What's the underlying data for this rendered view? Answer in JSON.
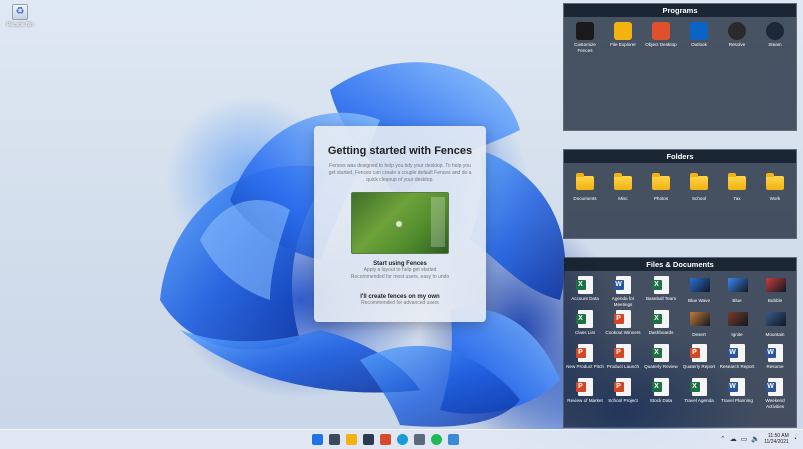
{
  "desktop": {
    "recycle_bin_label": "Recycle Bin"
  },
  "fences": {
    "programs": {
      "title": "Programs",
      "items": [
        {
          "label": "Customize Fences",
          "icon": "fences-icon",
          "color": "#1a1a1a"
        },
        {
          "label": "File Explorer",
          "icon": "folder-icon",
          "color": "#f2b20f"
        },
        {
          "label": "Object Desktop",
          "icon": "object-desktop-icon",
          "color": "#e0502a"
        },
        {
          "label": "Outlook",
          "icon": "outlook-icon",
          "color": "#0a64c8"
        },
        {
          "label": "Resolve",
          "icon": "resolve-icon",
          "color": "#2a2a2a"
        },
        {
          "label": "Steam",
          "icon": "steam-icon",
          "color": "#1b2838"
        }
      ]
    },
    "folders": {
      "title": "Folders",
      "items": [
        "Documents",
        "Misc",
        "Photos",
        "School",
        "Tax",
        "Work"
      ]
    },
    "files": {
      "title": "Files & Documents",
      "items": [
        {
          "label": "Account Data",
          "type": "excel"
        },
        {
          "label": "Agenda for Meetings",
          "type": "word"
        },
        {
          "label": "Baseball Team",
          "type": "excel"
        },
        {
          "label": "Blue Wave",
          "type": "image",
          "color": "#2a6fd6"
        },
        {
          "label": "Blue",
          "type": "image",
          "color": "#3b86ee"
        },
        {
          "label": "Bubble",
          "type": "image",
          "color": "#c43d3d"
        },
        {
          "label": "Class List",
          "type": "excel"
        },
        {
          "label": "Cookout Winners",
          "type": "powerpoint"
        },
        {
          "label": "Dashboards",
          "type": "excel"
        },
        {
          "label": "Desert",
          "type": "image",
          "color": "#c47a3a"
        },
        {
          "label": "Ignite",
          "type": "image",
          "color": "#7a3a2a"
        },
        {
          "label": "Mountain",
          "type": "image",
          "color": "#3a5a8a"
        },
        {
          "label": "New Product Pitch",
          "type": "powerpoint"
        },
        {
          "label": "Product Launch",
          "type": "powerpoint"
        },
        {
          "label": "Quaterly Review",
          "type": "excel"
        },
        {
          "label": "Quaterly Report",
          "type": "powerpoint"
        },
        {
          "label": "Research Report",
          "type": "word"
        },
        {
          "label": "Resume",
          "type": "word"
        },
        {
          "label": "Review of Market",
          "type": "powerpoint"
        },
        {
          "label": "School Project",
          "type": "powerpoint"
        },
        {
          "label": "Stock Data",
          "type": "excel"
        },
        {
          "label": "Travel Agenda",
          "type": "excel"
        },
        {
          "label": "Travel Planning",
          "type": "word"
        },
        {
          "label": "Weekend Activities",
          "type": "word"
        }
      ]
    }
  },
  "dialog": {
    "title": "Getting started with Fences",
    "body": "Fences was designed to help you tidy your desktop. To help you get started, Fences can create a couple default Fences and do a quick cleanup of your desktop.",
    "option1_title": "Start using Fences",
    "option1_sub1": "Apply a layout to help get started",
    "option1_sub2": "Recommended for most users, easy to undo",
    "option2_title": "I'll create fences on my own",
    "option2_sub": "Recommended for advanced users"
  },
  "taskbar": {
    "icons": [
      {
        "name": "start-icon",
        "color": "#1e73e8"
      },
      {
        "name": "search-icon",
        "color": "#3b4a5c"
      },
      {
        "name": "file-explorer-icon",
        "color": "#f2b20f"
      },
      {
        "name": "fences-taskbar-icon",
        "color": "#2a3a50"
      },
      {
        "name": "object-desktop-taskbar-icon",
        "color": "#d84a2a"
      },
      {
        "name": "edge-icon",
        "color": "#1a9ad6"
      },
      {
        "name": "settings-icon",
        "color": "#5a6a7a"
      },
      {
        "name": "spotify-icon",
        "color": "#1db954"
      },
      {
        "name": "store-icon",
        "color": "#3a8ad6"
      }
    ],
    "time": "11:50 AM",
    "date": "11/24/2021"
  },
  "colors": {
    "excel": "#1e7145",
    "word": "#2b579a",
    "powerpoint": "#d24726"
  }
}
